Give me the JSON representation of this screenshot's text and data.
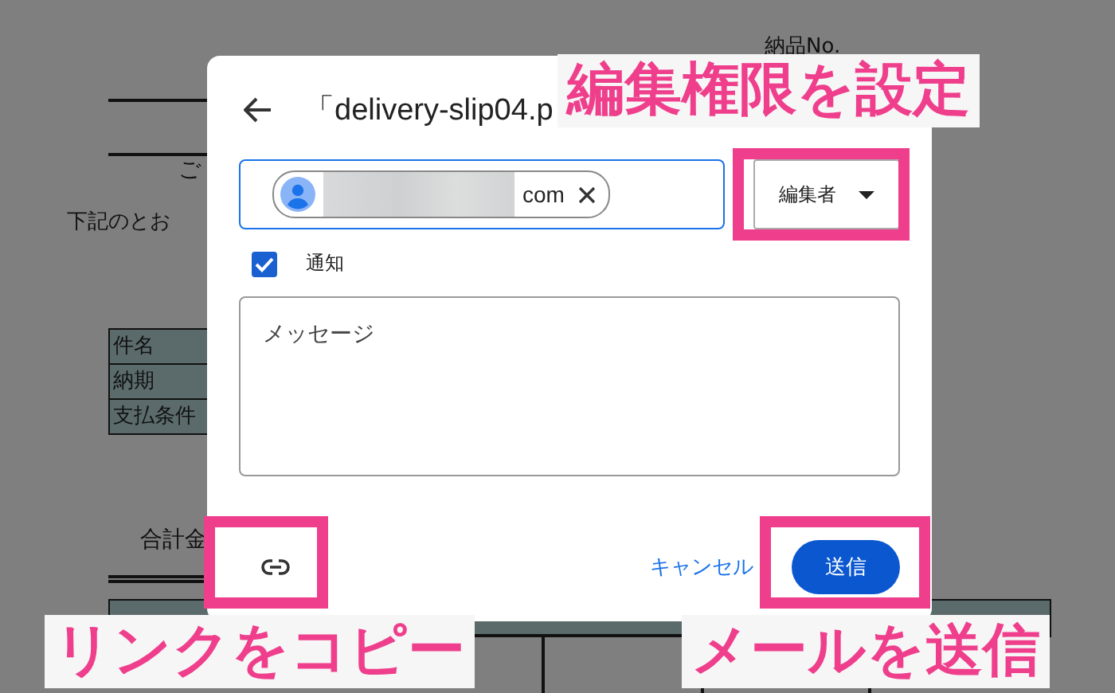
{
  "background_document": {
    "number_label": "納品No.",
    "greeting": "ご",
    "intro": "下記のとお",
    "info_rows": [
      {
        "label": "件名"
      },
      {
        "label": "納期"
      },
      {
        "label": "支払条件"
      }
    ],
    "total_label": "合計金"
  },
  "dialog": {
    "title": "「delivery-slip04.p",
    "recipient": {
      "email_suffix": "com"
    },
    "role_dropdown": {
      "label": "編集者"
    },
    "notify": {
      "label": "通知",
      "checked": true
    },
    "message": {
      "placeholder": "メッセージ"
    },
    "cancel_label": "キャンセル",
    "send_label": "送信"
  },
  "annotations": [
    {
      "text": "編集権限を設定"
    },
    {
      "text": "リンクをコピー"
    },
    {
      "text": "メールを送信"
    }
  ]
}
